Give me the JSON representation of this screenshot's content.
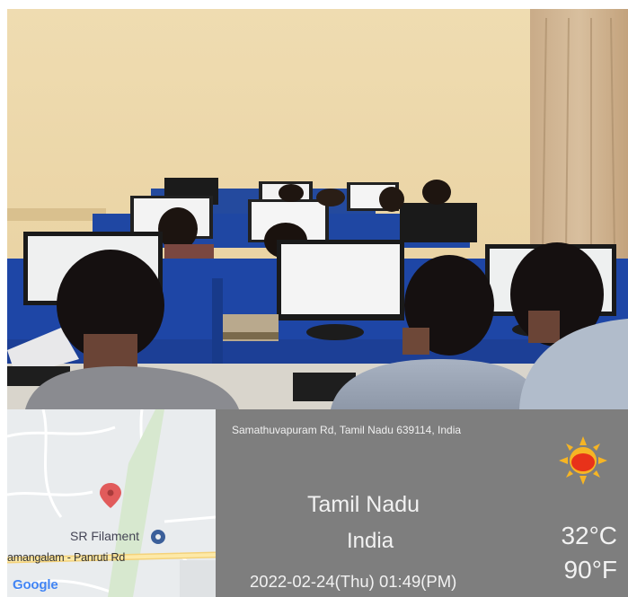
{
  "geotag": {
    "address": "Samathuvapuram Rd, Tamil Nadu 639114, India",
    "region": "Tamil Nadu",
    "country": "India",
    "datetime": "2022-02-24(Thu)  01:49(PM)",
    "temp_c": "32°C",
    "temp_f": "90°F",
    "weather_icon": "sun-icon"
  },
  "map": {
    "poi_label": "SR Filament",
    "road_label": "amangalam - Panruti Rd",
    "logo": "Google",
    "pin_icon": "location-pin-icon"
  },
  "colors": {
    "overlay": "#7e7e7e",
    "sun_body": "#e8321a",
    "sun_rays": "#f6b524",
    "map_bg": "#e9ecee",
    "google_blue": "#4285F4"
  }
}
